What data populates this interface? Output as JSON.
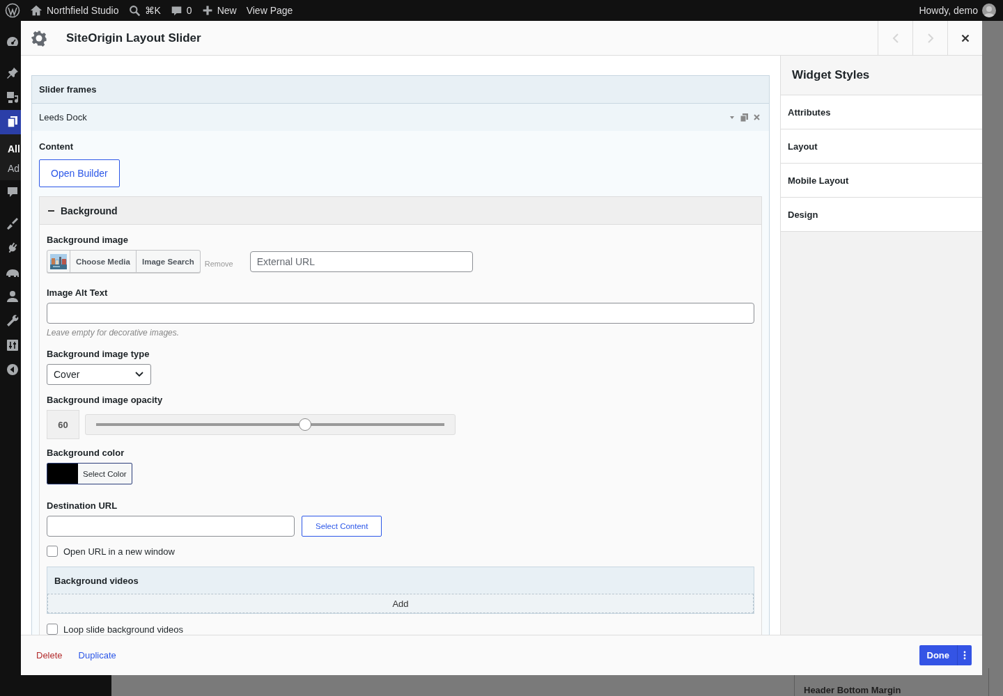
{
  "admin_bar": {
    "site_name": "Northfield Studio",
    "search_shortcut": "⌘K",
    "comment_count": "0",
    "new_label": "New",
    "view_label": "View Page",
    "greeting": "Howdy, demo"
  },
  "admin_menu": {
    "items": [
      {
        "selected": false
      },
      {
        "selected": false
      },
      {
        "selected": false
      },
      {
        "selected": true
      },
      {
        "selected": false
      },
      {
        "selected": false
      },
      {
        "selected": false
      },
      {
        "selected": false
      },
      {
        "selected": false
      },
      {
        "selected": false
      },
      {
        "selected": false
      },
      {
        "selected": false
      }
    ],
    "submenu": [
      {
        "label": "All",
        "selected": true
      },
      {
        "label": "Ad",
        "selected": false
      }
    ]
  },
  "modal": {
    "title": "SiteOrigin Layout Slider",
    "prev_disabled": true,
    "next_disabled": true
  },
  "slider_frames": {
    "title": "Slider frames",
    "frames": [
      {
        "title": "Leeds Dock",
        "expanded": true
      }
    ]
  },
  "content": {
    "label": "Content",
    "button": "Open Builder"
  },
  "background": {
    "title": "Background",
    "expanded": true,
    "image": {
      "label": "Background image",
      "choose": "Choose Media",
      "search": "Image Search",
      "remove": "Remove",
      "url_placeholder": "External URL"
    },
    "alt_text": {
      "label": "Image Alt Text",
      "description": "Leave empty for decorative images."
    },
    "image_type": {
      "label": "Background image type",
      "value": "Cover"
    },
    "opacity": {
      "label": "Background image opacity",
      "reading": "60",
      "level": 0.6
    },
    "color": {
      "label": "Background color",
      "button": "Select Color",
      "color": "#000000"
    },
    "destination": {
      "label": "Destination URL",
      "button": "Select Content"
    },
    "new_window": {
      "label": "Open URL in a new window",
      "checked": false
    },
    "videos": {
      "title": "Background videos",
      "add": "Add"
    },
    "loop_videos": {
      "label": "Loop slide background videos",
      "checked": false
    }
  },
  "widget_styles": {
    "title": "Widget Styles",
    "items": [
      {
        "label": "Attributes"
      },
      {
        "label": "Layout"
      },
      {
        "label": "Mobile Layout"
      },
      {
        "label": "Design"
      }
    ]
  },
  "footer": {
    "delete": "Delete",
    "duplicate": "Duplicate",
    "done": "Done"
  },
  "backdrop": {
    "setting_label": "Header Bottom Margin"
  }
}
